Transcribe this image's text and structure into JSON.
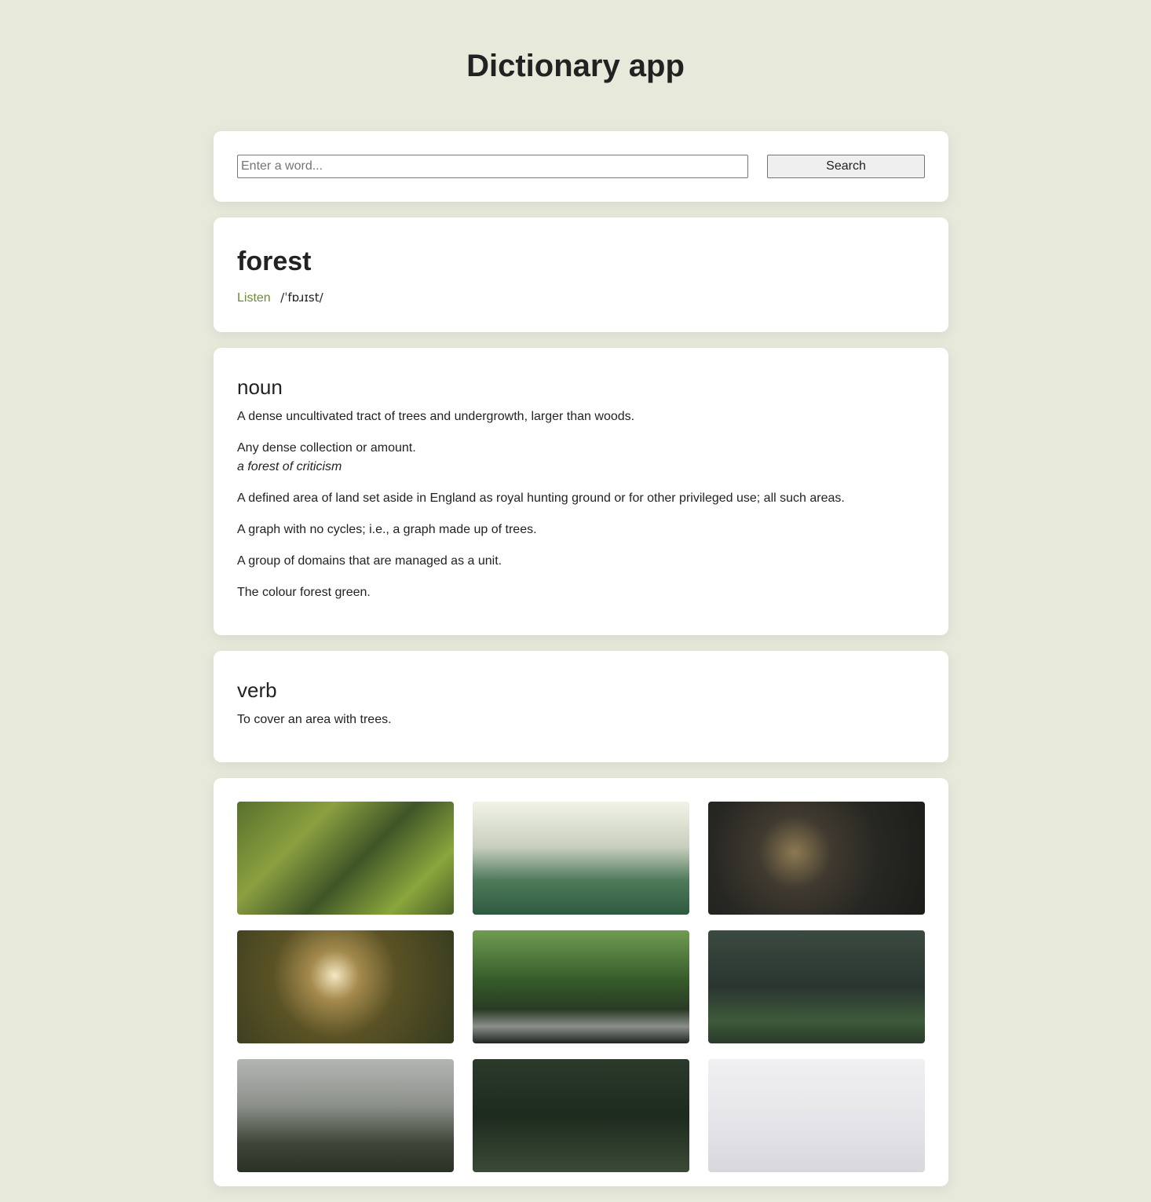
{
  "app": {
    "title": "Dictionary app"
  },
  "search": {
    "placeholder": "Enter a word...",
    "value": "",
    "button_label": "Search"
  },
  "word": {
    "text": "forest",
    "listen_label": "Listen",
    "phonetic": "/ˈfɒɹɪst/"
  },
  "meanings": {
    "noun": {
      "label": "noun",
      "definitions": [
        {
          "text": "A dense uncultivated tract of trees and undergrowth, larger than woods."
        },
        {
          "text": "Any dense collection or amount.",
          "example": "a forest of criticism"
        },
        {
          "text": "A defined area of land set aside in England as royal hunting ground or for other privileged use; all such areas."
        },
        {
          "text": "A graph with no cycles; i.e., a graph made up of trees."
        },
        {
          "text": "A group of domains that are managed as a unit."
        },
        {
          "text": "The colour forest green."
        }
      ]
    },
    "verb": {
      "label": "verb",
      "definitions": [
        {
          "text": "To cover an area with trees."
        }
      ]
    }
  },
  "images": [
    {
      "name": "forest-image-1"
    },
    {
      "name": "forest-image-2"
    },
    {
      "name": "forest-image-3"
    },
    {
      "name": "forest-image-4"
    },
    {
      "name": "forest-image-5"
    },
    {
      "name": "forest-image-6"
    },
    {
      "name": "forest-image-7"
    },
    {
      "name": "forest-image-8"
    },
    {
      "name": "forest-image-9"
    }
  ],
  "colors": {
    "background": "#e7eadb",
    "accent": "#6f8a3c",
    "card": "#ffffff"
  }
}
